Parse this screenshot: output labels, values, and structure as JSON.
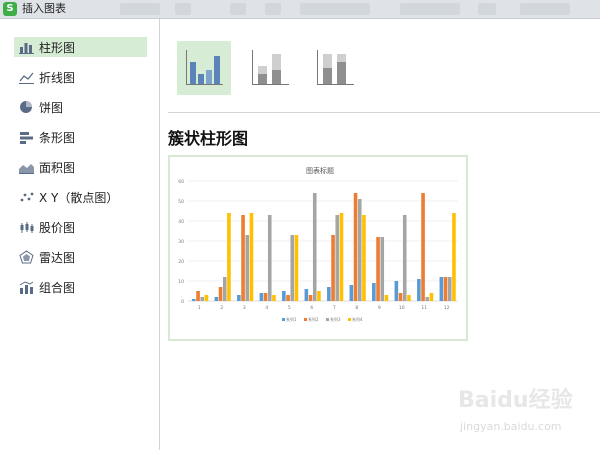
{
  "window": {
    "title": "插入图表",
    "app_icon_letter": "S"
  },
  "sidebar": {
    "items": [
      {
        "label": "柱形图",
        "icon": "column-chart-icon",
        "selected": true
      },
      {
        "label": "折线图",
        "icon": "line-chart-icon"
      },
      {
        "label": "饼图",
        "icon": "pie-chart-icon"
      },
      {
        "label": "条形图",
        "icon": "bar-chart-icon"
      },
      {
        "label": "面积图",
        "icon": "area-chart-icon"
      },
      {
        "label": "X Y（散点图）",
        "icon": "scatter-chart-icon"
      },
      {
        "label": "股价图",
        "icon": "stock-chart-icon"
      },
      {
        "label": "雷达图",
        "icon": "radar-chart-icon"
      },
      {
        "label": "组合图",
        "icon": "combo-chart-icon"
      }
    ]
  },
  "subtypes": [
    {
      "name": "clustered-column",
      "selected": true
    },
    {
      "name": "stacked-column"
    },
    {
      "name": "percent-stacked-column"
    }
  ],
  "selected_type_title": "簇状柱形图",
  "preview": {
    "colors": [
      "#5b9bd5",
      "#ed7d31",
      "#a5a5a5",
      "#ffc000"
    ],
    "chart_data": {
      "type": "bar",
      "title": "图表标题",
      "categories": [
        "1",
        "2",
        "3",
        "4",
        "5",
        "6",
        "7",
        "8",
        "9",
        "10",
        "11",
        "12"
      ],
      "series": [
        {
          "values": [
            1,
            2,
            3,
            4,
            5,
            6,
            7,
            8,
            9,
            10,
            11,
            12
          ]
        },
        {
          "values": [
            5,
            7,
            43,
            4,
            3,
            3,
            33,
            54,
            32,
            4,
            54,
            12
          ]
        },
        {
          "values": [
            2,
            12,
            33,
            43,
            33,
            54,
            43,
            51,
            32,
            43,
            2,
            12
          ]
        },
        {
          "values": [
            3,
            44,
            44,
            3,
            33,
            5,
            44,
            43,
            3,
            3,
            4,
            44
          ]
        }
      ],
      "yticks": [
        "0",
        "10",
        "20",
        "30",
        "40",
        "50",
        "60"
      ],
      "ylim": [
        0,
        60
      ],
      "legend": [
        "系列1",
        "系列2",
        "系列3",
        "系列4"
      ],
      "legend_position": "bottom",
      "grid": true
    }
  },
  "watermark": {
    "brand": "Baidu经验",
    "url": "jingyan.baidu.com"
  },
  "sidebar_icon_color": "#5a6b85",
  "accent_selected_bg": "#d7ecd5"
}
